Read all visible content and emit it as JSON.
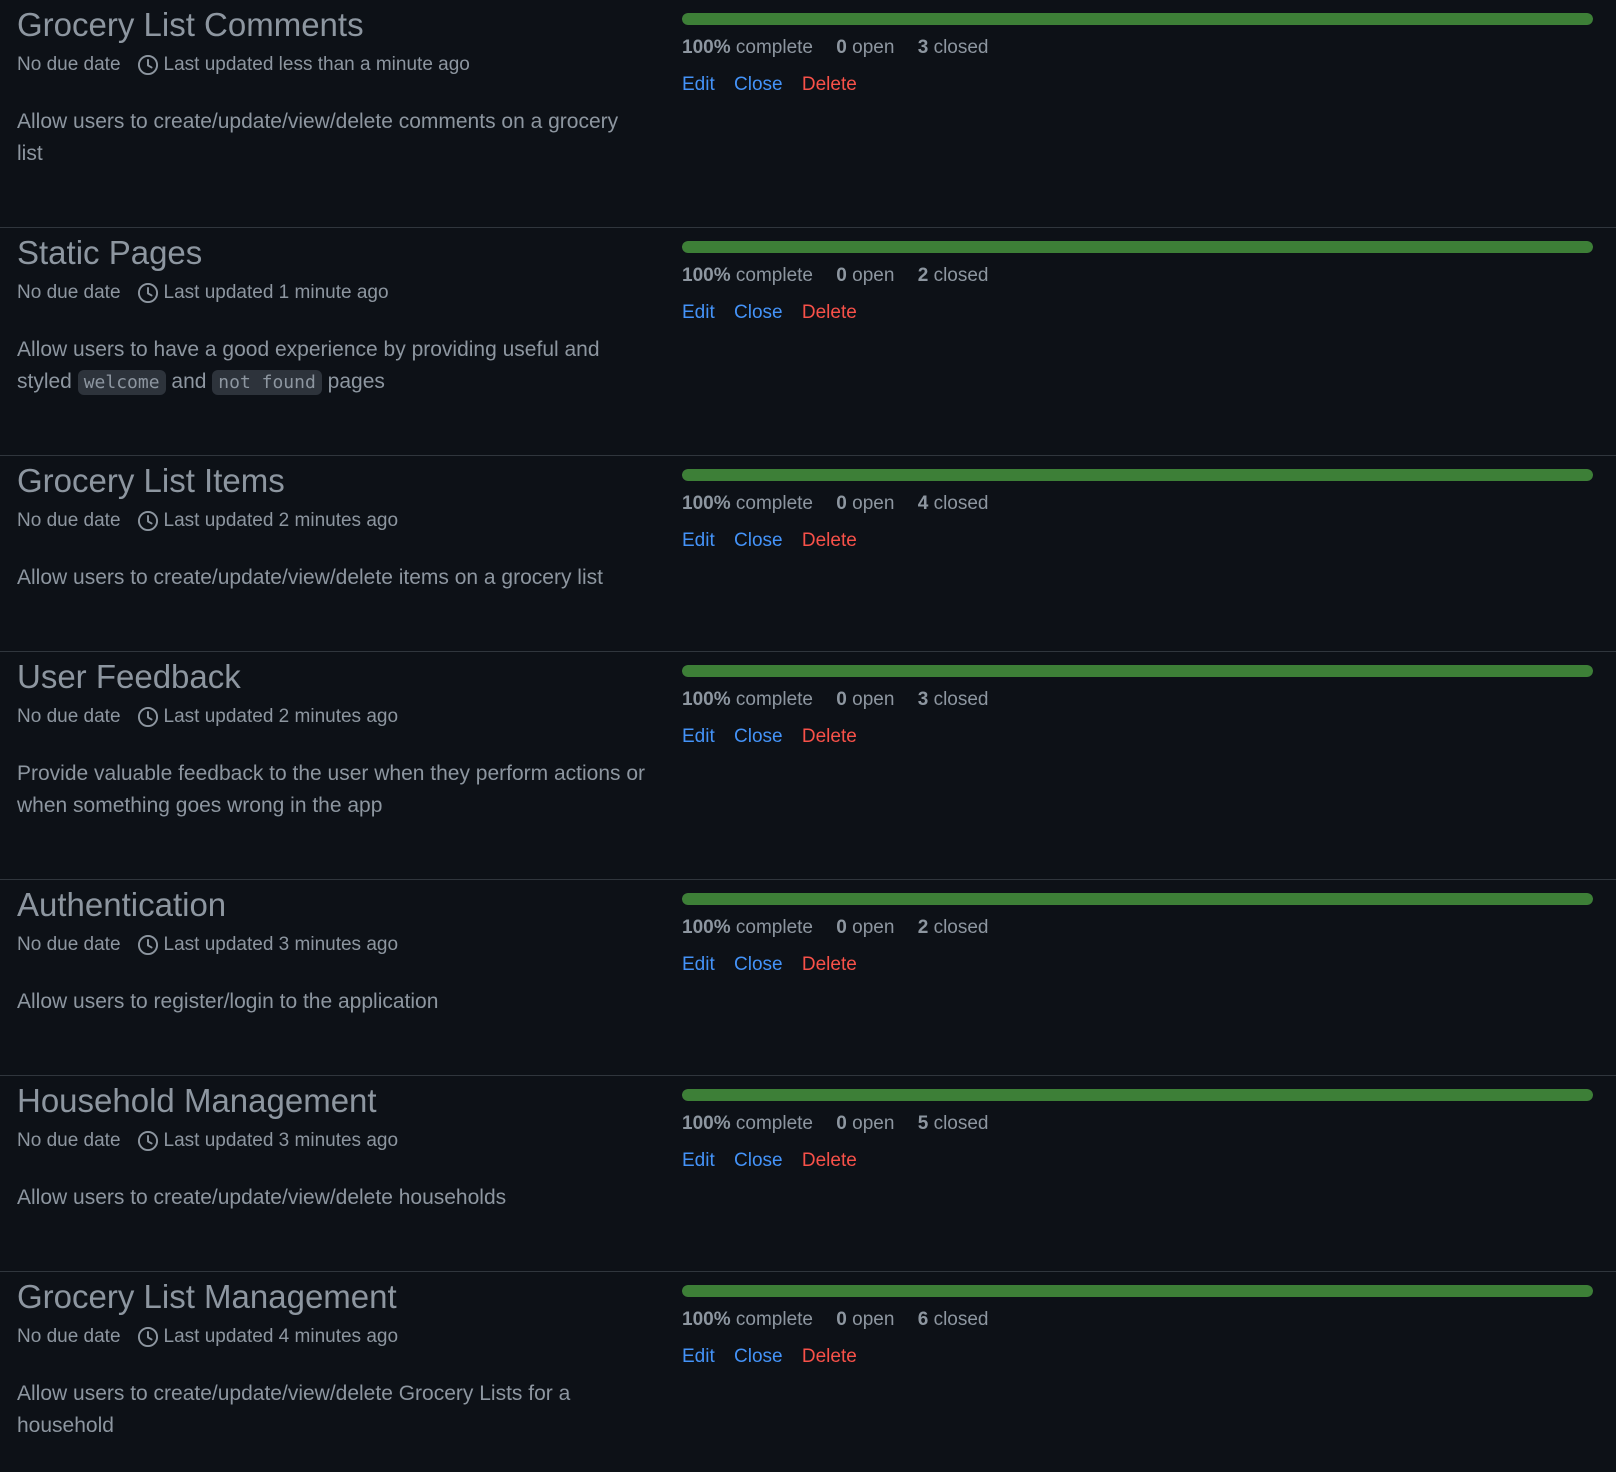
{
  "colors": {
    "background": "#0d1117",
    "text": "#8d96a0",
    "link": "#4493f8",
    "danger": "#f85149",
    "progress": "#3d7f37",
    "divider": "#30363d"
  },
  "labels": {
    "no_due_date": "No due date",
    "complete_suffix": "complete",
    "open_suffix": "open",
    "closed_suffix": "closed",
    "edit": "Edit",
    "close": "Close",
    "delete": "Delete"
  },
  "milestones": [
    {
      "title": "Grocery List Comments",
      "updated": "Last updated less than a minute ago",
      "description": [
        {
          "text": "Allow users to create/update/view/delete comments on a grocery list"
        }
      ],
      "percent_label": "100%",
      "progress_percent": 100,
      "open": "0",
      "closed": "3"
    },
    {
      "title": "Static Pages",
      "updated": "Last updated 1 minute ago",
      "description": [
        {
          "text": "Allow users to have a good experience by providing useful and styled "
        },
        {
          "code": "welcome"
        },
        {
          "text": " and "
        },
        {
          "code": "not found"
        },
        {
          "text": " pages"
        }
      ],
      "percent_label": "100%",
      "progress_percent": 100,
      "open": "0",
      "closed": "2"
    },
    {
      "title": "Grocery List Items",
      "updated": "Last updated 2 minutes ago",
      "description": [
        {
          "text": "Allow users to create/update/view/delete items on a grocery list"
        }
      ],
      "percent_label": "100%",
      "progress_percent": 100,
      "open": "0",
      "closed": "4"
    },
    {
      "title": "User Feedback",
      "updated": "Last updated 2 minutes ago",
      "description": [
        {
          "text": "Provide valuable feedback to the user when they perform actions or when something goes wrong in the app"
        }
      ],
      "percent_label": "100%",
      "progress_percent": 100,
      "open": "0",
      "closed": "3"
    },
    {
      "title": "Authentication",
      "updated": "Last updated 3 minutes ago",
      "description": [
        {
          "text": "Allow users to register/login to the application"
        }
      ],
      "percent_label": "100%",
      "progress_percent": 100,
      "open": "0",
      "closed": "2"
    },
    {
      "title": "Household Management",
      "updated": "Last updated 3 minutes ago",
      "description": [
        {
          "text": "Allow users to create/update/view/delete households"
        }
      ],
      "percent_label": "100%",
      "progress_percent": 100,
      "open": "0",
      "closed": "5"
    },
    {
      "title": "Grocery List Management",
      "updated": "Last updated 4 minutes ago",
      "description": [
        {
          "text": "Allow users to create/update/view/delete Grocery Lists for a household"
        }
      ],
      "percent_label": "100%",
      "progress_percent": 100,
      "open": "0",
      "closed": "6"
    }
  ]
}
